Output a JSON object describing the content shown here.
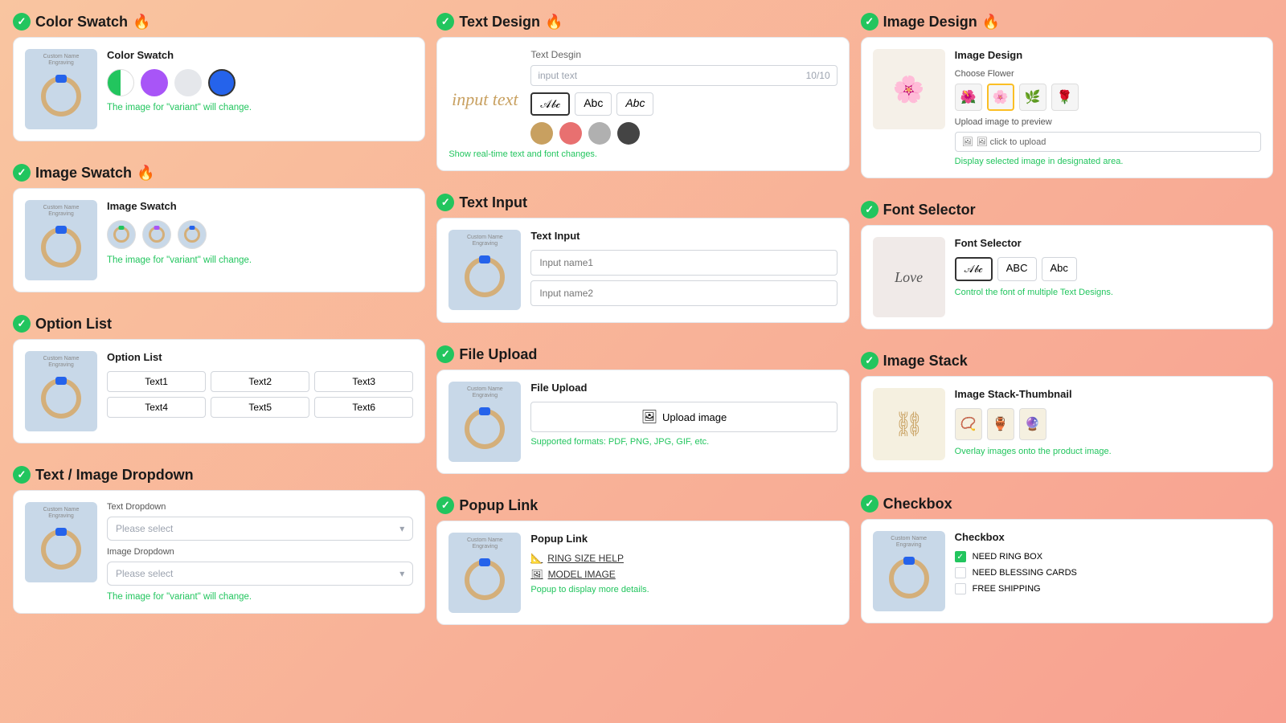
{
  "sections": {
    "col1": {
      "colorSwatch": {
        "title": "Color Swatch",
        "fire": "🔥",
        "cardLabel": "Color Swatch",
        "variantText": "The image for \"variant\" will change.",
        "swatches": [
          "half-green-white",
          "purple",
          "grey",
          "blue"
        ]
      },
      "imageSwatch": {
        "title": "Image Swatch",
        "fire": "🔥",
        "cardLabel": "Image Swatch",
        "variantText": "The image for \"variant\" will change.",
        "swatches": [
          "green-gem",
          "purple-gem",
          "blue-gem"
        ]
      },
      "optionList": {
        "title": "Option List",
        "cardLabel": "Option List",
        "options": [
          "Text1",
          "Text2",
          "Text3",
          "Text4",
          "Text5",
          "Text6"
        ]
      },
      "textImageDropdown": {
        "title": "Text / Image Dropdown",
        "textDropdownLabel": "Text Dropdown",
        "textDropdownPlaceholder": "Please select",
        "imageDropdownLabel": "Image Dropdown",
        "imageDropdownPlaceholder": "Please select",
        "variantText": "The image for \"variant\" will change."
      }
    },
    "col2": {
      "textDesign": {
        "title": "Text Design",
        "fire": "🔥",
        "cardTitle": "Text Desgin",
        "inputPlaceholder": "input text",
        "inputCount": "10/10",
        "scriptLabel": "input text",
        "fonts": [
          "𝒜𝓫𝒸",
          "Abc",
          "𝐴𝑏𝑐"
        ],
        "colors": [
          "#c8a060",
          "#e87070",
          "#b0b0b0",
          "#444444"
        ],
        "note": "Show real-time text and font changes."
      },
      "textInput": {
        "title": "Text Input",
        "cardLabel": "Text  Input",
        "fields": [
          "Input name1",
          "Input name2"
        ]
      },
      "fileUpload": {
        "title": "File Upload",
        "cardLabel": "File Upload",
        "uploadBtn": "Upload image",
        "supportedText": "Supported formats: PDF, PNG, JPG, GIF, etc."
      },
      "popupLink": {
        "title": "Popup Link",
        "cardLabel": "Popup Link",
        "links": [
          "RING SIZE HELP",
          "MODEL IMAGE"
        ],
        "note": "Popup to display more details."
      }
    },
    "col3": {
      "imageDesign": {
        "title": "Image Design",
        "fire": "🔥",
        "cardLabel": "Image Design",
        "subLabel": "Choose Flower",
        "flowers": [
          "🌺",
          "🌸",
          "🌿",
          "🌹"
        ],
        "uploadLabel": "Upload image to preview",
        "uploadBtn": "🖼 click to upload",
        "note": "Display selected image in designated area."
      },
      "fontSelector": {
        "title": "Font Selector",
        "cardLabel": "Font Selector",
        "fonts": [
          "𝒜𝓫𝒸",
          "ABC",
          "Abc"
        ],
        "note": "Control the font of multiple Text Designs.",
        "loveText": "Love"
      },
      "imageStack": {
        "title": "Image Stack",
        "cardLabel": "Image Stack-Thumbnail",
        "thumbs": [
          "📿",
          "🏺",
          "🔮"
        ],
        "note": "Overlay images onto the product image."
      },
      "checkbox": {
        "title": "Checkbox",
        "cardLabel": "Checkbox",
        "items": [
          {
            "label": "NEED RING BOX",
            "checked": true
          },
          {
            "label": "NEED BLESSING CARDS",
            "checked": false
          },
          {
            "label": "FREE SHIPPING",
            "checked": false
          }
        ]
      }
    }
  }
}
